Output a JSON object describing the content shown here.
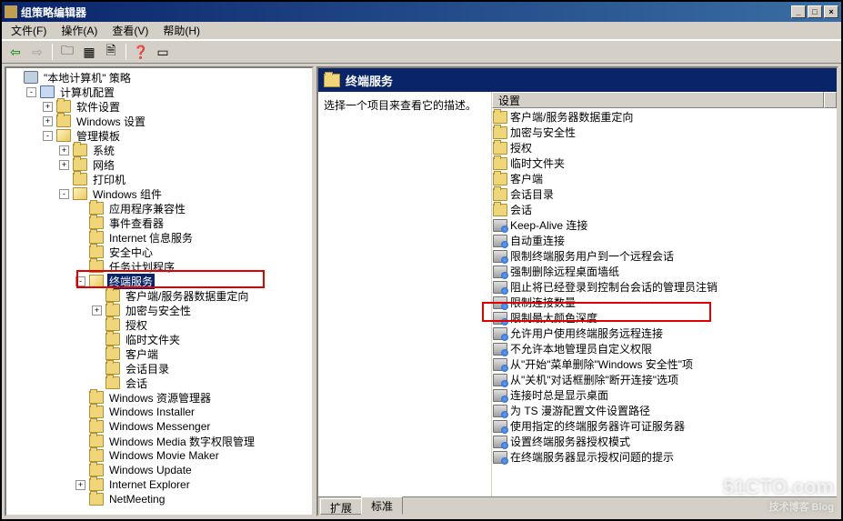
{
  "window": {
    "title": "组策略编辑器"
  },
  "menubar": {
    "file": "文件(F)",
    "action": "操作(A)",
    "view": "查看(V)",
    "help": "帮助(H)"
  },
  "tree": {
    "root": "\"本地计算机\" 策略",
    "computer_config": "计算机配置",
    "software_settings": "软件设置",
    "windows_settings": "Windows 设置",
    "admin_templates": "管理模板",
    "system": "系统",
    "network": "网络",
    "printers": "打印机",
    "windows_components": "Windows 组件",
    "app_compat": "应用程序兼容性",
    "event_viewer": "事件查看器",
    "iis": "Internet 信息服务",
    "security_center": "安全中心",
    "task_scheduler": "任务计划程序",
    "terminal_services": "终端服务",
    "client_server_redirect": "客户端/服务器数据重定向",
    "encrypt_security": "加密与安全性",
    "authorization": "授权",
    "temp_folders": "临时文件夹",
    "client": "客户端",
    "session_dir": "会话目录",
    "sessions": "会话",
    "wrm": "Windows 资源管理器",
    "winstaller": "Windows Installer",
    "messenger": "Windows Messenger",
    "wmedia_drm": "Windows Media 数字权限管理",
    "wmovie_maker": "Windows Movie Maker",
    "wupdate": "Windows Update",
    "ie": "Internet Explorer",
    "netmeeting": "NetMeeting"
  },
  "right": {
    "header": "终端服务",
    "desc": "选择一个项目来查看它的描述。",
    "column": "设置",
    "tab_extended": "扩展",
    "tab_standard": "标准"
  },
  "settings": [
    {
      "t": "客户端/服务器数据重定向",
      "k": "folder"
    },
    {
      "t": "加密与安全性",
      "k": "folder"
    },
    {
      "t": "授权",
      "k": "folder"
    },
    {
      "t": "临时文件夹",
      "k": "folder"
    },
    {
      "t": "客户端",
      "k": "folder"
    },
    {
      "t": "会话目录",
      "k": "folder"
    },
    {
      "t": "会话",
      "k": "folder"
    },
    {
      "t": "Keep-Alive 连接",
      "k": "setting"
    },
    {
      "t": "自动重连接",
      "k": "setting"
    },
    {
      "t": "限制终端服务用户到一个远程会话",
      "k": "setting"
    },
    {
      "t": "强制删除远程桌面墙纸",
      "k": "setting"
    },
    {
      "t": "阻止将已经登录到控制台会话的管理员注销",
      "k": "setting"
    },
    {
      "t": "限制连接数量",
      "k": "setting"
    },
    {
      "t": "限制最大颜色深度",
      "k": "setting"
    },
    {
      "t": "允许用户使用终端服务远程连接",
      "k": "setting"
    },
    {
      "t": "不允许本地管理员自定义权限",
      "k": "setting"
    },
    {
      "t": "从\"开始\"菜单删除\"Windows 安全性\"项",
      "k": "setting"
    },
    {
      "t": "从\"关机\"对话框删除\"断开连接\"选项",
      "k": "setting"
    },
    {
      "t": "连接时总是显示桌面",
      "k": "setting"
    },
    {
      "t": "为 TS 漫游配置文件设置路径",
      "k": "setting"
    },
    {
      "t": "使用指定的终端服务器许可证服务器",
      "k": "setting"
    },
    {
      "t": "设置终端服务器授权模式",
      "k": "setting"
    },
    {
      "t": "在终端服务器显示授权问题的提示",
      "k": "setting"
    }
  ],
  "watermark": {
    "main": "51CTO.com",
    "sub": "技术博客   Blog"
  }
}
